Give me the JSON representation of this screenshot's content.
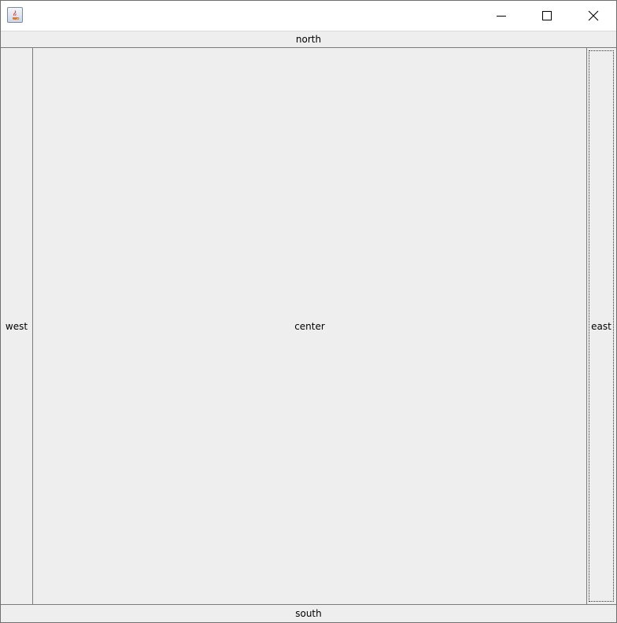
{
  "window": {
    "icon": "java-app-icon",
    "controls": {
      "minimize": "minimize-icon",
      "maximize": "maximize-icon",
      "close": "close-icon"
    }
  },
  "layout": {
    "north": "north",
    "west": "west",
    "center": "center",
    "east": "east",
    "south": "south"
  },
  "colors": {
    "panel_background": "#eeeeee",
    "titlebar_background": "#ffffff",
    "border": "#7a7a7a"
  }
}
